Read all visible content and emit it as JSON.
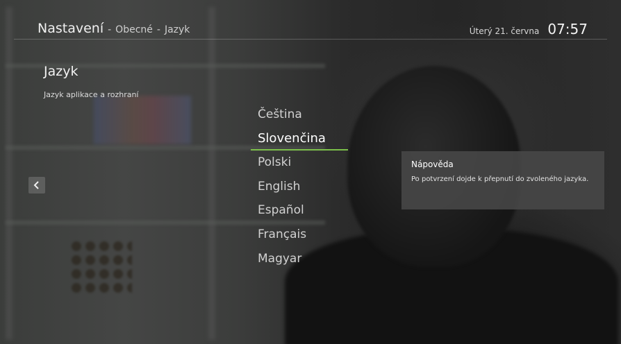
{
  "header": {
    "breadcrumb": {
      "main": "Nastavení",
      "separator": "-",
      "level1": "Obecné",
      "level2": "Jazyk"
    },
    "date": "Úterý 21. června",
    "time": "07:57"
  },
  "page": {
    "title": "Jazyk",
    "subtitle": "Jazyk aplikace a rozhraní"
  },
  "languages": {
    "items": [
      {
        "label": "Čeština"
      },
      {
        "label": "Slovenčina"
      },
      {
        "label": "Polski"
      },
      {
        "label": "English"
      },
      {
        "label": "Español"
      },
      {
        "label": "Français"
      },
      {
        "label": "Magyar"
      }
    ],
    "selected_index": 1
  },
  "help": {
    "title": "Nápověda",
    "text": "Po potvrzení dojde k přepnutí do zvoleného jazyka."
  },
  "icons": {
    "back": "chevron-left-icon"
  },
  "colors": {
    "accent": "#7cc04a",
    "panel": "#484848"
  }
}
